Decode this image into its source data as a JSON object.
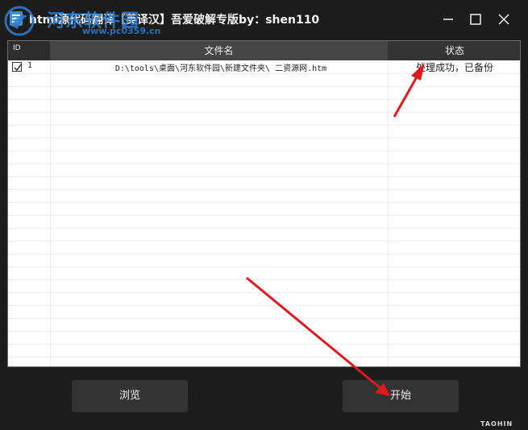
{
  "window": {
    "title": "html源代码翻译【英译汉】吾爱破解专版by：shen110",
    "controls": {
      "minimize_icon": "minimize-icon",
      "maximize_icon": "maximize-icon",
      "close_icon": "close-icon"
    }
  },
  "watermark": {
    "text": "河东软件园",
    "url": "www.pc0359.cn"
  },
  "table": {
    "columns": [
      "ID",
      "文件名",
      "状态"
    ],
    "rows": [
      {
        "checked": true,
        "id": "1",
        "file": "D:\\tools\\桌面\\河东软件园\\新建文件夹\\ 二资源网.htm",
        "status": "处理成功，已备份"
      }
    ]
  },
  "buttons": {
    "browse": "浏览",
    "start": "开始"
  },
  "brand": "TAOHIN",
  "colors": {
    "background": "#1c1c1c",
    "button": "#333333",
    "header_name": "#454545",
    "arrow": "#e0191e",
    "watermark": "#2f7fd0"
  }
}
